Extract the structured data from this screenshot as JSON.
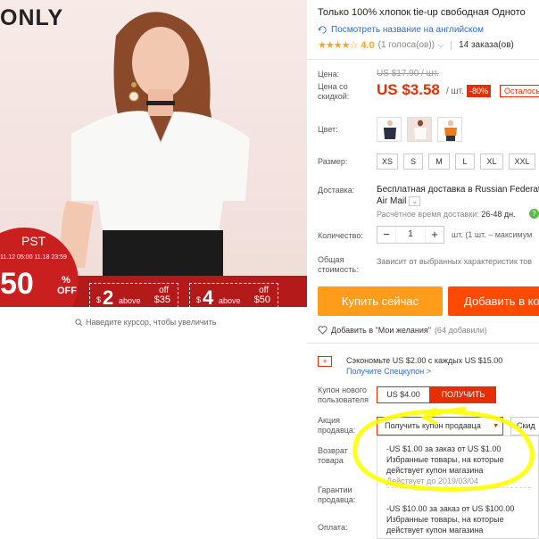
{
  "image": {
    "brand": "ONLY",
    "promo": {
      "pst": "PST",
      "dates": "11.12 05:00 11.18 23:59",
      "big_percent": "50",
      "percent_sign": "%",
      "off_label": "OFF",
      "vouchers": [
        {
          "currency": "$",
          "amount": "2",
          "off": "off",
          "above": "above",
          "min": "$35"
        },
        {
          "currency": "$",
          "amount": "4",
          "off": "off",
          "above": "above",
          "min": "$50"
        }
      ]
    },
    "zoom_hint": "Наведите курсор, чтобы увеличить"
  },
  "product": {
    "title": "Только 100% хлопок tie-up свободная Одното",
    "translate_link": "Посмотреть название на английском",
    "stars": "★★★★☆",
    "rating": "4.0",
    "votes": "(1 голоса(ов))",
    "orders": "14 заказа(ов)"
  },
  "price": {
    "label_price": "Цена:",
    "label_discount": "Цена со скидкой:",
    "old": "US $17.90 / шт.",
    "new": "US $3.58",
    "per_unit": "/ шт.",
    "discount": "-80%",
    "remaining": "Осталось"
  },
  "options": {
    "color_label": "Цвет:",
    "size_label": "Размер:",
    "sizes": [
      "XS",
      "S",
      "M",
      "L",
      "XL",
      "XXL"
    ]
  },
  "shipping": {
    "label": "Доставка:",
    "line1": "Бесплатная доставка в Russian Federat",
    "line2": "Air Mail",
    "estimate_label": "Расчётное время доставки:",
    "estimate_value": "26-48 дн."
  },
  "quantity": {
    "label": "Количество:",
    "value": "1",
    "minus": "−",
    "plus": "+",
    "note": "шт. (1 шт. – максимум"
  },
  "total": {
    "label": "Общая стоимость:",
    "note": "Зависит от выбранных характеристик тов"
  },
  "actions": {
    "buy": "Купить сейчас",
    "cart": "Добавить в ко",
    "wishlist": "Добавить в \"Мои желания\"",
    "wish_count": "(64 добавили)"
  },
  "coupons": {
    "save_text": "Сэкономьте US $2.00 с каждых US $15.00",
    "save_link": "Получите Спецкупон >",
    "new_user_label": "Купон нового пользователя",
    "new_user_amount": "US $4.00",
    "get_button": "ПОЛУЧИТЬ",
    "seller_label": "Акция продавца:",
    "seller_dropdown": "Получить купон продавца",
    "seller_dropdown2": "Скид",
    "return_label": "Возврат товара",
    "guarantee_label": "Гарантии продавца:",
    "payment_label": "Оплата:",
    "items": [
      {
        "line1": "-US $1.00 за заказ от US $1.00",
        "line2": "Избранные товары, на которые",
        "line3": "действует купон магазина",
        "valid": "Действует до 2019/03/04"
      },
      {
        "line1": "-US $10.00 за заказ от US $100.00",
        "line2": "Избранные товары, на которые",
        "line3": "действует купон магазина"
      }
    ]
  },
  "colors": {
    "accent_red": "#e62e04",
    "buy_orange": "#ff9c1a",
    "cart_orange": "#ff4a00",
    "link_blue": "#2a6fc9",
    "promo_red": "#b51a1a",
    "annotation_yellow": "#ffff00"
  }
}
